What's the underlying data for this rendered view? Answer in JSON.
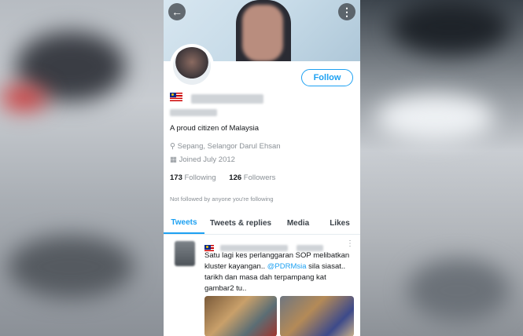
{
  "profile": {
    "follow_label": "Follow",
    "bio": "A proud citizen of Malaysia",
    "location": "Sepang, Selangor Darul Ehsan",
    "joined": "Joined July 2012",
    "following_count": "173",
    "following_label": "Following",
    "followers_count": "126",
    "followers_label": "Followers",
    "followed_by_note": "Not followed by anyone you're following"
  },
  "tabs": [
    {
      "label": "Tweets",
      "active": true
    },
    {
      "label": "Tweets & replies",
      "active": false
    },
    {
      "label": "Media",
      "active": false
    },
    {
      "label": "Likes",
      "active": false
    }
  ],
  "tweet": {
    "text_lead": "Satu lagi kes perlanggaran SOP melibatkan kluster kayangan.. ",
    "mention": "@PDRMsia",
    "text_tail": " sila siasat.. tarikh dan masa dah terpampang kat gambar2 tu.."
  },
  "icons": {
    "back": "back-arrow-icon",
    "more": "more-vertical-icon",
    "location": "location-pin-icon",
    "calendar": "calendar-icon",
    "flag": "malaysia-flag-icon"
  },
  "colors": {
    "accent": "#1da1f2",
    "text": "#14171a",
    "muted": "#8a9096"
  }
}
